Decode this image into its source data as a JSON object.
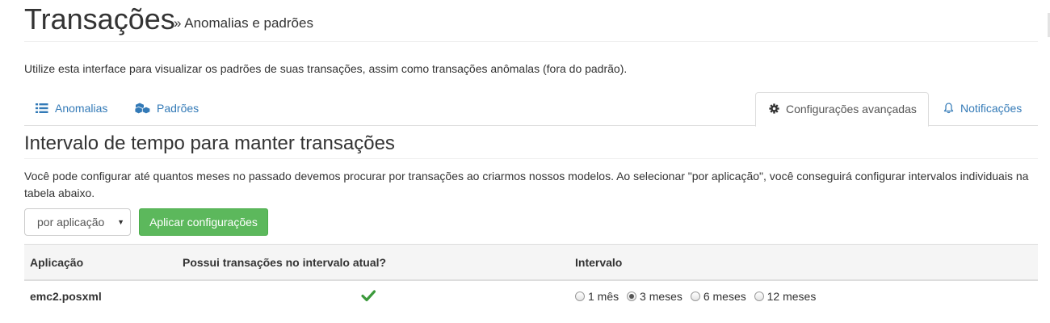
{
  "header": {
    "title": "Transações",
    "subtitle": "» Anomalias e padrões"
  },
  "intro": "Utilize esta interface para visualizar os padrões de suas transações, assim como transações anômalas (fora do padrão).",
  "tabs": [
    {
      "label": "Anomalias",
      "icon": "list-icon",
      "active": false
    },
    {
      "label": "Padrões",
      "icon": "cubes-icon",
      "active": false
    },
    {
      "label": "Configurações avançadas",
      "icon": "gear-icon",
      "active": true
    },
    {
      "label": "Notificações",
      "icon": "bell-icon",
      "active": false
    }
  ],
  "section": {
    "title": "Intervalo de tempo para manter transações",
    "help": "Você pode configurar até quantos meses no passado devemos procurar por transações ao criarmos nossos modelos. Ao selecionar \"por aplicação\", você conseguirá configurar intervalos individuais na tabela abaixo."
  },
  "controls": {
    "mode_selected": "por aplicação",
    "apply_label": "Aplicar configurações"
  },
  "table": {
    "headers": [
      "Aplicação",
      "Possui transações no intervalo atual?",
      "Intervalo"
    ],
    "rows": [
      {
        "app": "emc2.posxml",
        "has_transactions": true,
        "intervals": [
          "1 mês",
          "3 meses",
          "6 meses",
          "12 meses"
        ],
        "selected_interval": "3 meses"
      }
    ]
  },
  "colors": {
    "link": "#337ab7",
    "success": "#5cb85c",
    "check": "#3c9a3c"
  }
}
